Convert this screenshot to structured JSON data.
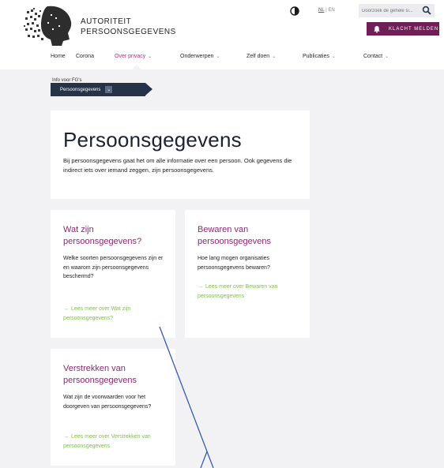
{
  "header": {
    "brand_line1": "AUTORITEIT",
    "brand_line2": "PERSOONSGEGEVENS",
    "lang_nl": "NL",
    "lang_sep": " | ",
    "lang_en": "EN",
    "search_placeholder": "Doorzoek de gehele si...",
    "complaint_label": "KLACHT MELDEN"
  },
  "nav": {
    "items": [
      "Home",
      "Corona",
      "Over privacy",
      "Onderwerpen",
      "Zelf doen",
      "Publicaties",
      "Contact"
    ],
    "active": "Over privacy"
  },
  "breadcrumb": {
    "info": "Info voor FG's",
    "current": "Persoonsgegevens"
  },
  "hero": {
    "title": "Persoonsgegevens",
    "description": "Bij persoonsgegevens gaat het om alle informatie over een persoon. Ook gegevens die indirect iets over iemand zeggen, zijn persoonsgegevens."
  },
  "cards": [
    {
      "title": "Wat zijn persoonsgegevens?",
      "text": "Welke soorten persoonsgegevens zijn er en waarom zijn persoonsgegevens beschermd?",
      "link": "Lees meer over Wat zijn persoonsgegevens?"
    },
    {
      "title": "Bewaren van persoonsgegevens",
      "text": "Hoe lang mogen organisaties persoonsgegevens bewaren?",
      "link": "Lees meer over Bewaren van persoonsgegevens"
    },
    {
      "title": "Verstrekken van persoonsgegevens",
      "text": "Wat zijn de voorwaarden voor het doorgeven van persoonsgegevens?",
      "link": "Lees meer over Verstrekken van persoonsgegevens"
    }
  ],
  "colors": {
    "accent": "#6e1f56",
    "title_purple": "#8a2a72",
    "link_green": "#7fbf4d",
    "breadcrumb_navy": "#253349",
    "nav_active": "#b52f79"
  },
  "icons": {
    "contrast": "contrast-icon",
    "search": "search-icon",
    "bell": "bell-icon",
    "arrow": "arrow-right-icon",
    "chevron": "chevron-down-icon"
  }
}
